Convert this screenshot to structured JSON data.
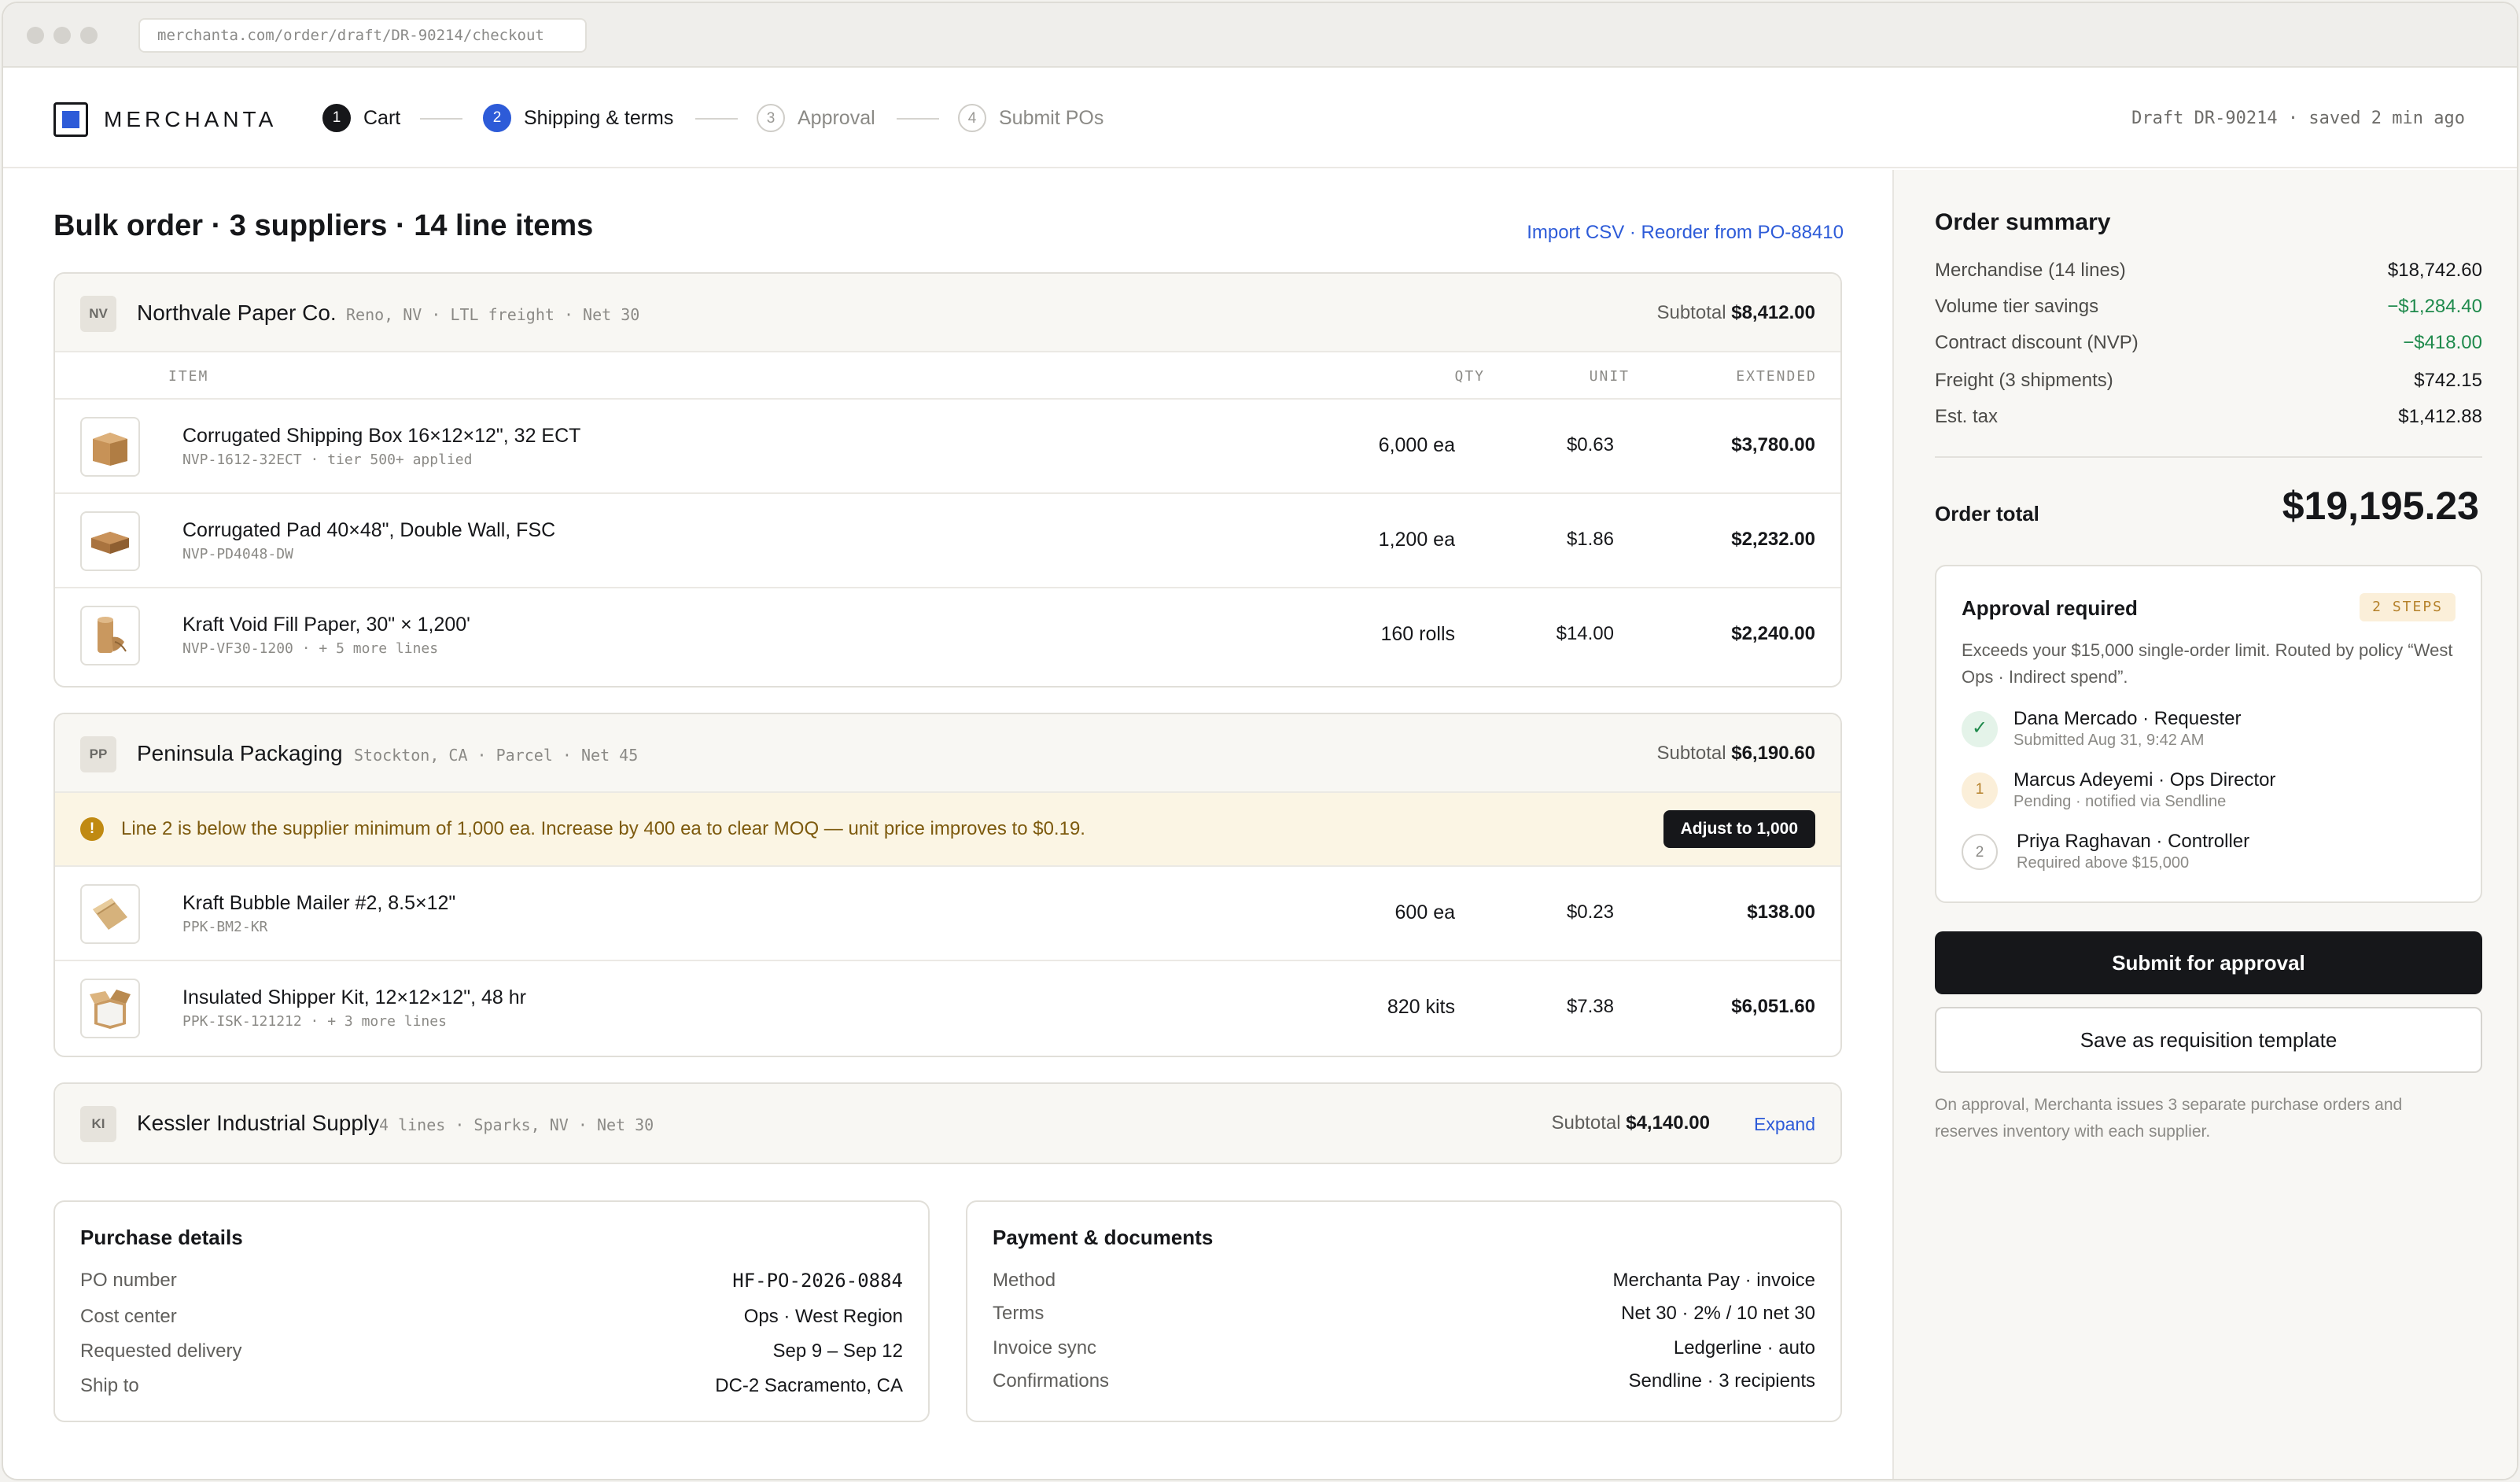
{
  "browser": {
    "url": "merchanta.com/order/draft/DR-90214/checkout"
  },
  "header": {
    "brand": "MERCHANTA",
    "steps": [
      {
        "num": "1",
        "label": "Cart",
        "state": "done"
      },
      {
        "num": "2",
        "label": "Shipping & terms",
        "state": "current"
      },
      {
        "num": "3",
        "label": "Approval",
        "state": "todo"
      },
      {
        "num": "4",
        "label": "Submit POs",
        "state": "todo"
      }
    ],
    "draft_status": "Draft DR-90214 · saved 2 min ago"
  },
  "main": {
    "title": "Bulk order · 3 suppliers · 14 line items",
    "actions": "Import CSV · Reorder from PO-88410",
    "columns": {
      "item": "ITEM",
      "qty": "QTY",
      "unit": "UNIT",
      "extended": "EXTENDED"
    },
    "suppliers": [
      {
        "badge": "NV",
        "name": "Northvale Paper Co.",
        "meta": "Reno, NV · LTL freight · Net 30",
        "subtotal_label": "Subtotal",
        "subtotal": "$8,412.00",
        "items": [
          {
            "name": "Corrugated Shipping Box 16×12×12\", 32 ECT",
            "sku": "NVP-1612-32ECT · tier 500+ applied",
            "qty": "6,000 ea",
            "unit": "$0.63",
            "extended": "$3,780.00",
            "icon": "box-icon"
          },
          {
            "name": "Corrugated Pad 40×48\", Double Wall, FSC",
            "sku": "NVP-PD4048-DW",
            "qty": "1,200 ea",
            "unit": "$1.86",
            "extended": "$2,232.00",
            "icon": "pad-icon"
          },
          {
            "name": "Kraft Void Fill Paper, 30\" × 1,200'",
            "sku": "NVP-VF30-1200 · + 5 more lines",
            "qty": "160 rolls",
            "unit": "$14.00",
            "extended": "$2,240.00",
            "icon": "paper-roll-icon"
          }
        ]
      },
      {
        "badge": "PP",
        "name": "Peninsula Packaging",
        "meta": "Stockton, CA · Parcel · Net 45",
        "subtotal_label": "Subtotal",
        "subtotal": "$6,190.60",
        "warning": {
          "icon": "!",
          "text": "Line 2 is below the supplier minimum of 1,000 ea. Increase by 400 ea to clear MOQ — unit price improves to $0.19.",
          "action": "Adjust to 1,000"
        },
        "items": [
          {
            "name": "Kraft Bubble Mailer #2, 8.5×12\"",
            "sku": "PPK-BM2-KR",
            "qty": "600 ea",
            "unit": "$0.23",
            "extended": "$138.00",
            "icon": "mailer-icon"
          },
          {
            "name": "Insulated Shipper Kit, 12×12×12\", 48 hr",
            "sku": "PPK-ISK-121212 · + 3 more lines",
            "qty": "820 kits",
            "unit": "$7.38",
            "extended": "$6,051.60",
            "icon": "insulated-box-icon"
          }
        ]
      },
      {
        "badge": "KI",
        "name": "Kessler Industrial Supply",
        "meta": "4 lines · Sparks, NV · Net 30",
        "subtotal_label": "Subtotal",
        "subtotal": "$4,140.00",
        "expand_label": "Expand"
      }
    ],
    "purchase_details": {
      "title": "Purchase details",
      "rows": [
        {
          "k": "PO number",
          "v": "HF-PO-2026-0884"
        },
        {
          "k": "Cost center",
          "v": "Ops · West Region"
        },
        {
          "k": "Requested delivery",
          "v": "Sep 9 – Sep 12"
        },
        {
          "k": "Ship to",
          "v": "DC-2 Sacramento, CA"
        }
      ]
    },
    "payment": {
      "title": "Payment & documents",
      "rows": [
        {
          "k": "Method",
          "v": "Merchanta Pay · invoice"
        },
        {
          "k": "Terms",
          "v": "Net 30 · 2% / 10 net 30"
        },
        {
          "k": "Invoice sync",
          "v": "Ledgerline · auto"
        },
        {
          "k": "Confirmations",
          "v": "Sendline · 3 recipients"
        }
      ]
    }
  },
  "summary": {
    "title": "Order summary",
    "rows": [
      {
        "k": "Merchandise (14 lines)",
        "v": "$18,742.60"
      },
      {
        "k": "Volume tier savings",
        "v": "−$1,284.40"
      },
      {
        "k": "Contract discount (NVP)",
        "v": "−$418.00"
      },
      {
        "k": "Freight (3 shipments)",
        "v": "$742.15"
      },
      {
        "k": "Est. tax",
        "v": "$1,412.88"
      }
    ],
    "total_label": "Order total",
    "total": "$19,195.23",
    "approval": {
      "title": "Approval required",
      "badge": "2 STEPS",
      "description": "Exceeds your $15,000 single-order limit. Routed by policy “West Ops · Indirect spend”.",
      "steps": [
        {
          "marker": "✓",
          "name": "Dana Mercado · Requester",
          "status": "Submitted Aug 31, 9:42 AM"
        },
        {
          "marker": "1",
          "name": "Marcus Adeyemi · Ops Director",
          "status": "Pending · notified via Sendline"
        },
        {
          "marker": "2",
          "name": "Priya Raghavan · Controller",
          "status": "Required above $15,000"
        }
      ]
    },
    "submit_label": "Submit for approval",
    "save_label": "Save as requisition template",
    "footnote": "On approval, Merchanta issues 3 separate purchase orders and reserves inventory with each supplier.",
    "colors": {
      "accent": "#2d5bd8",
      "savings": "#1f8a4c",
      "warning_bg": "#fbf5e4",
      "primary_button": "#16171a"
    }
  }
}
